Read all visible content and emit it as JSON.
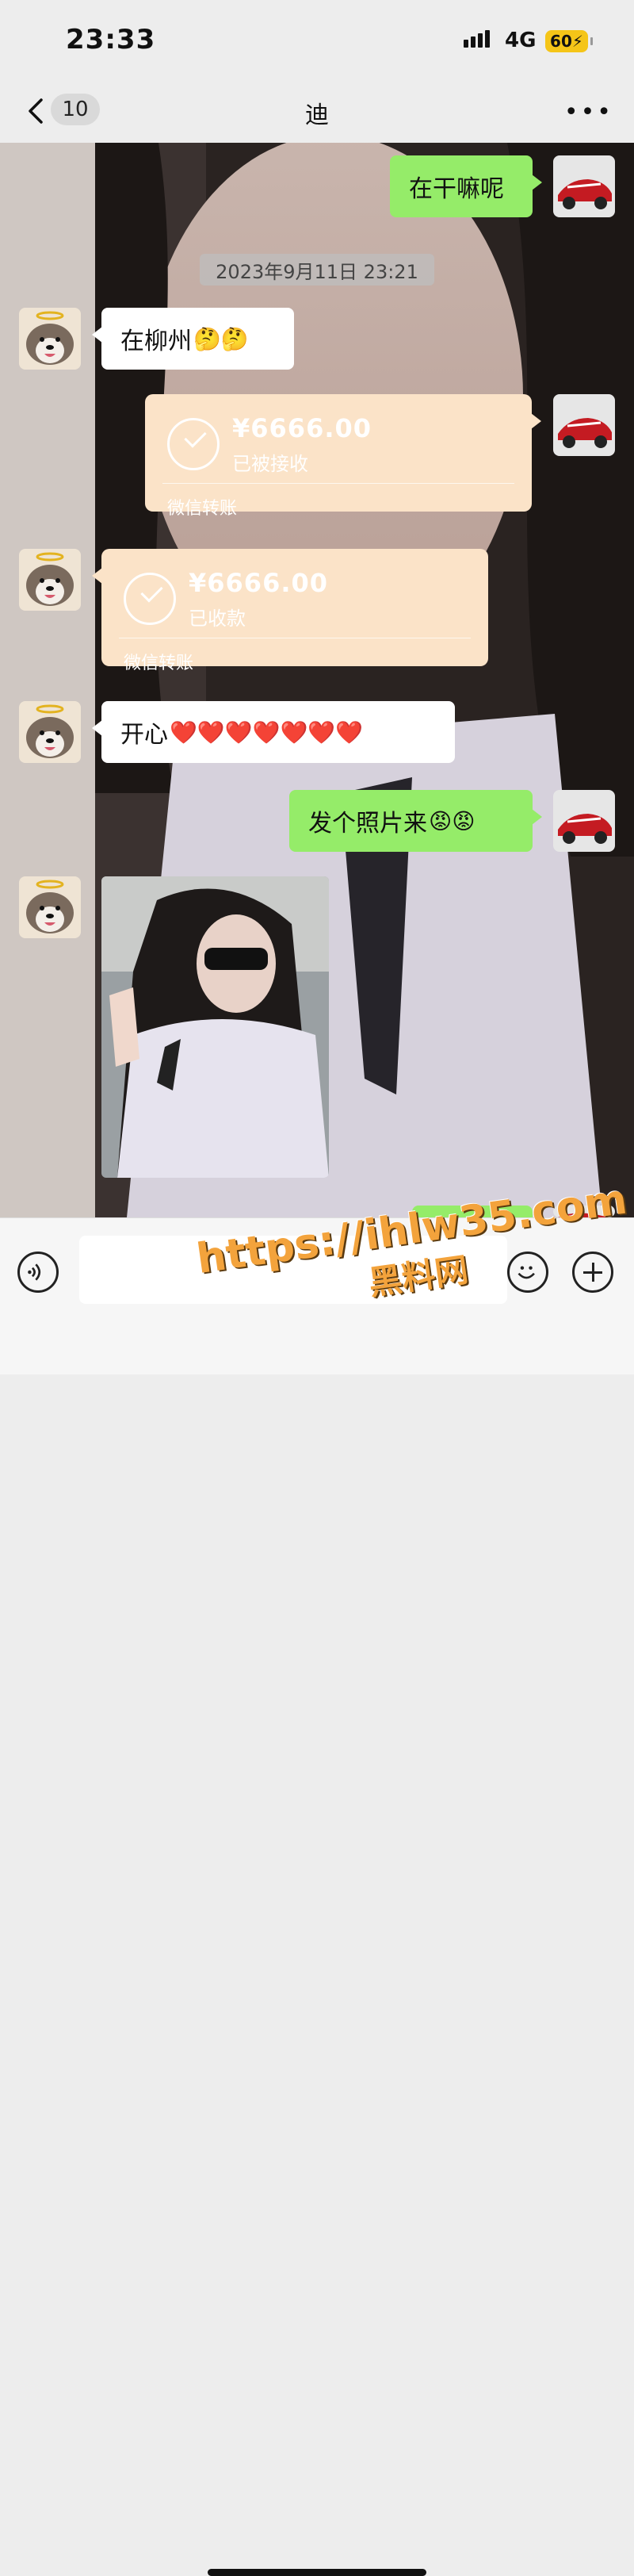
{
  "status_bar": {
    "time": "23:33",
    "network": "4G",
    "battery": "60"
  },
  "nav": {
    "unread_count": "10",
    "title": "迪"
  },
  "messages": {
    "m1": {
      "text": "在干嘛呢"
    },
    "timestamp": "2023年9月11日 23:21",
    "m2": {
      "text": "在柳州",
      "emoji": "🤔🤔"
    },
    "t1": {
      "amount": "¥6666.00",
      "status": "已被接收",
      "label": "微信转账"
    },
    "t2": {
      "amount": "¥6666.00",
      "status": "已收款",
      "label": "微信转账"
    },
    "m3": {
      "text": "开心",
      "emoji": "❤️❤️❤️❤️❤️❤️❤️"
    },
    "m4": {
      "text": "发个照片来",
      "emoji": "😡😡"
    }
  },
  "watermark": {
    "url": "https://ihlw35.com",
    "text": "黑料网"
  },
  "colors": {
    "sent_bubble": "#95ec69",
    "received_bubble": "#ffffff",
    "transfer_bubble": "#fbe3c8",
    "background": "#ededed"
  },
  "icons": [
    "back-chevron-icon",
    "more-icon",
    "voice-icon",
    "emoji-icon",
    "plus-icon"
  ]
}
